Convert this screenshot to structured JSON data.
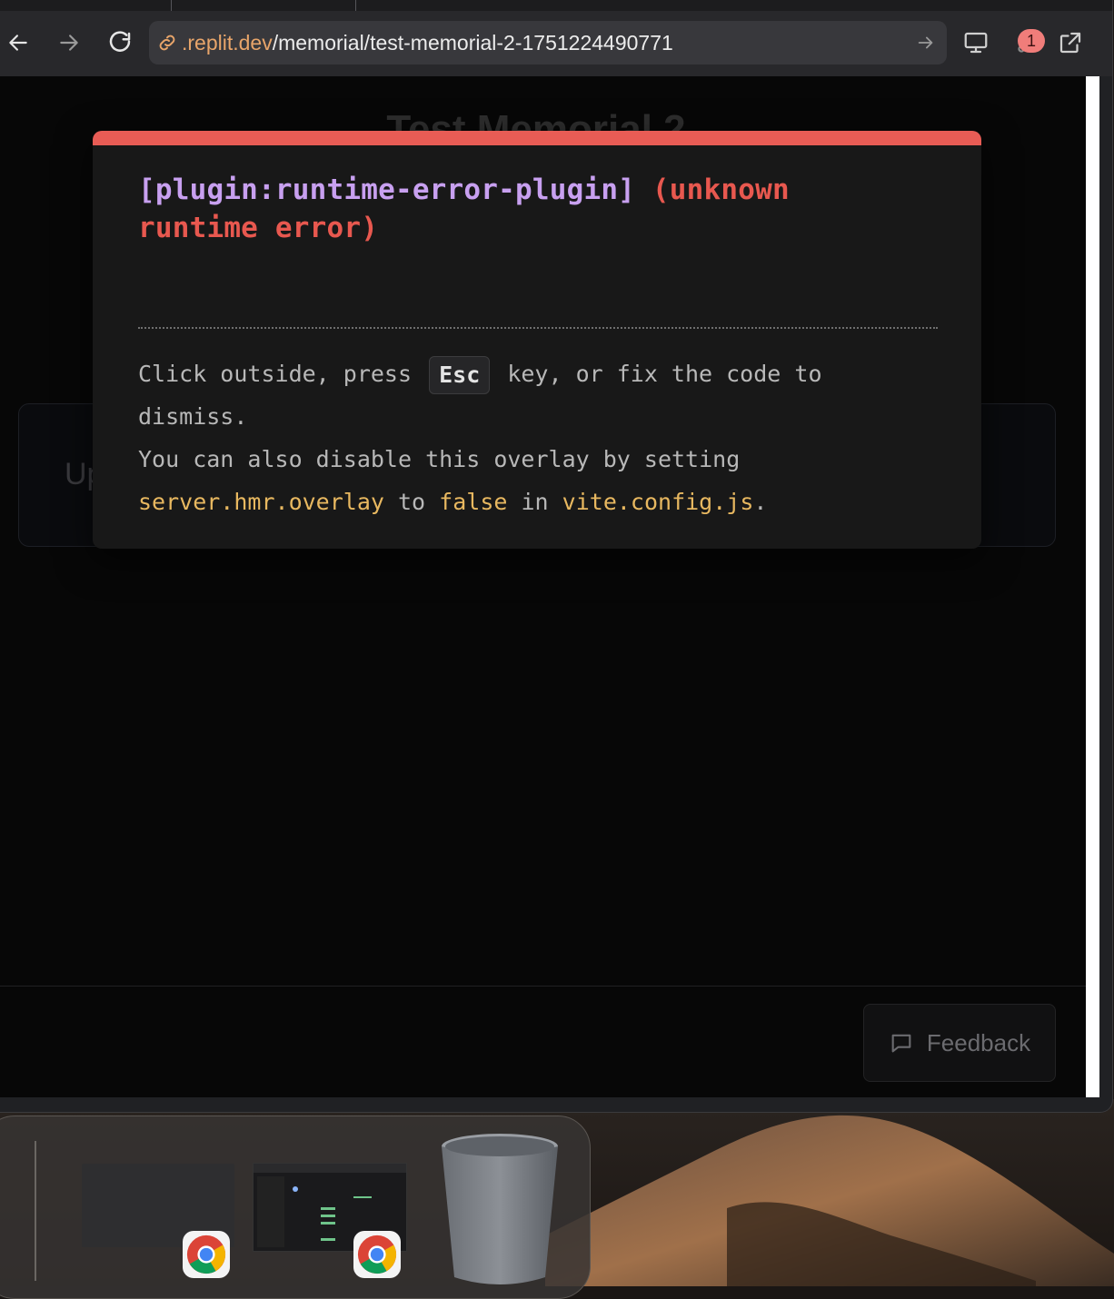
{
  "browser": {
    "url_domain": ".replit.dev",
    "url_path": "/memorial/test-memorial-2-1751224490771",
    "notification_count": "1"
  },
  "page": {
    "title": "Test Memorial 2",
    "upload_partial": "Up",
    "feedback_label": "Feedback"
  },
  "overlay": {
    "plugin": "[plugin:runtime-error-plugin]",
    "error": "(unknown runtime error)",
    "tip_part1": "Click outside, press",
    "esc_key": "Esc",
    "tip_part2": "key, or fix the code to dismiss.",
    "tip_part3": "You can also disable this overlay by setting",
    "code_setting": "server.hmr.overlay",
    "tip_to": "to",
    "code_false": "false",
    "tip_in": "in",
    "code_file": "vite.config.js",
    "tip_end": "."
  },
  "colors": {
    "accent_error": "#e85c55",
    "plugin_purple": "#c8a0f0",
    "code_yellow": "#e8b860",
    "domain_orange": "#e8a56a"
  }
}
